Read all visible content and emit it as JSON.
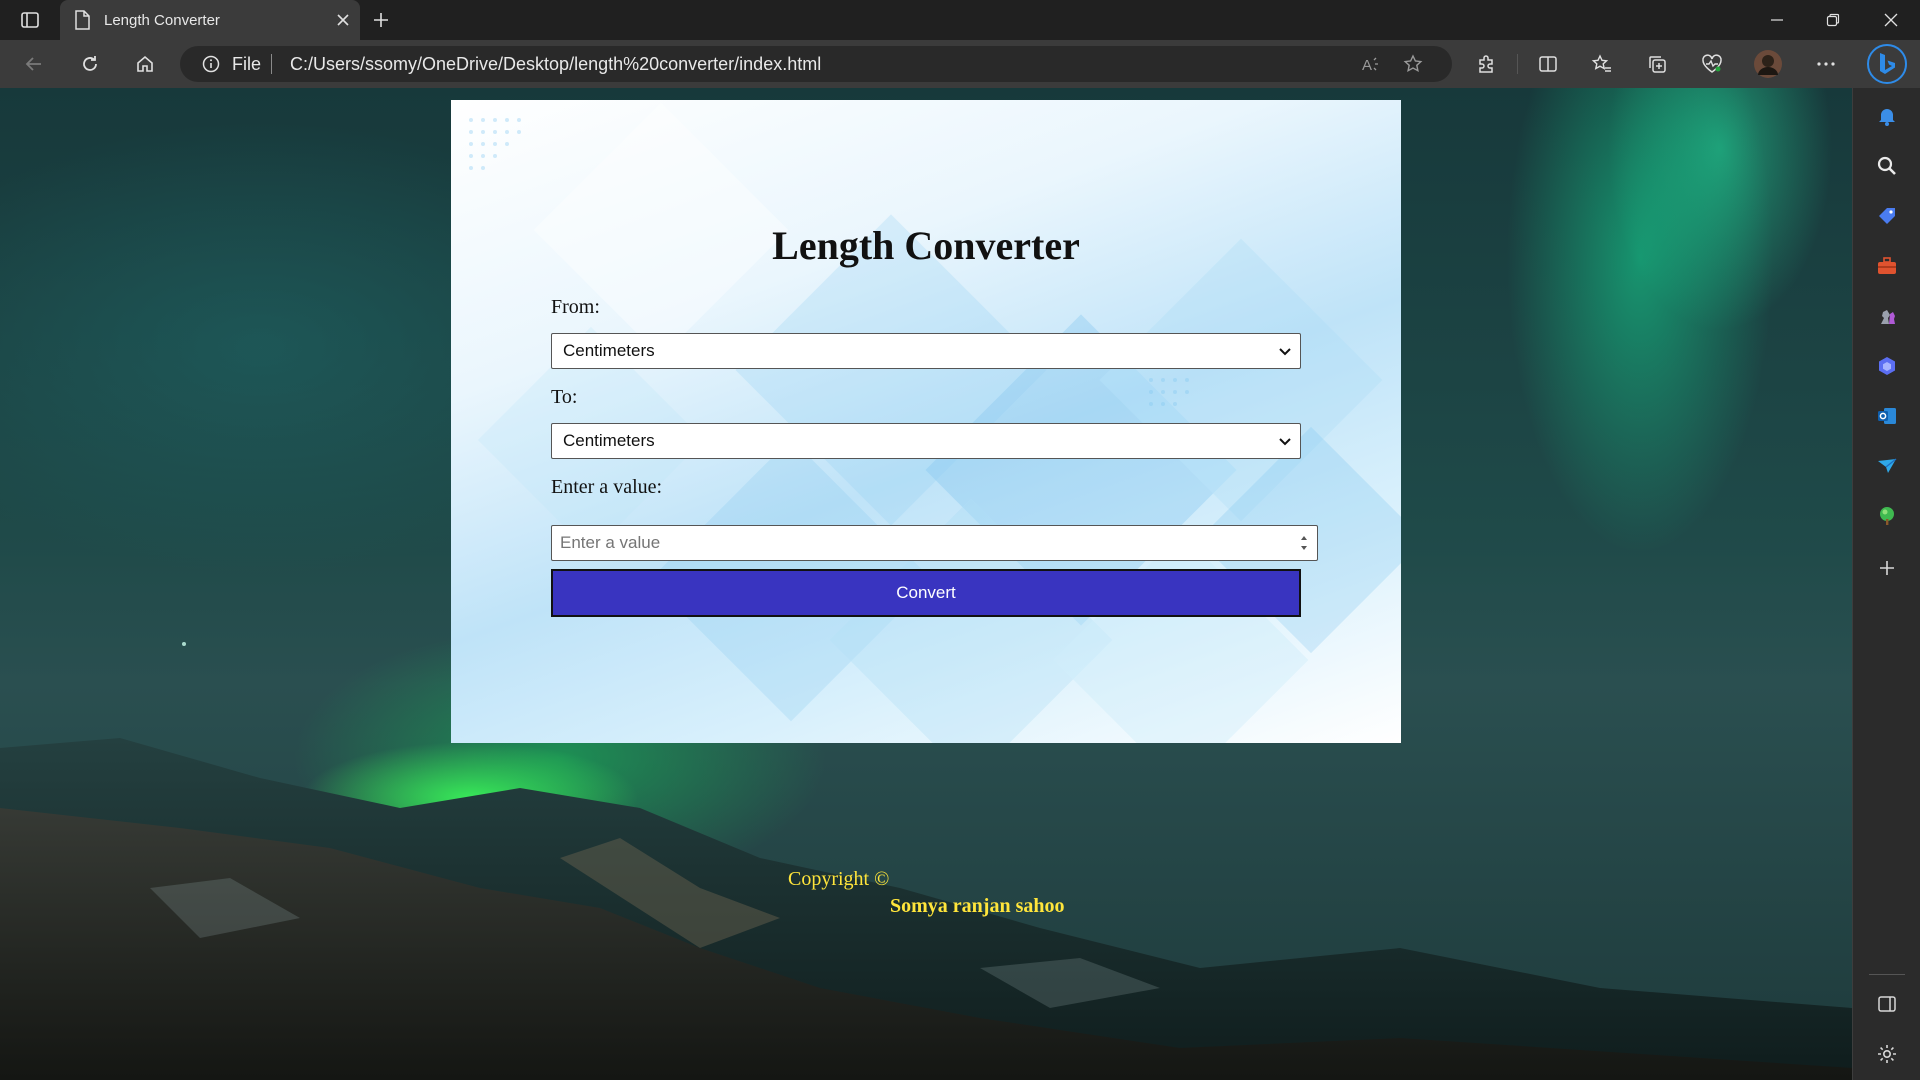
{
  "browser": {
    "tab_title": "Length Converter",
    "address_protocol": "File",
    "address_url": "C:/Users/ssomy/OneDrive/Desktop/length%20converter/index.html"
  },
  "converter": {
    "title": "Length Converter",
    "from_label": "From:",
    "from_value": "Centimeters",
    "to_label": "To:",
    "to_value": "Centimeters",
    "value_label": "Enter a value:",
    "value_placeholder": "Enter a value",
    "convert_label": "Convert"
  },
  "footer": {
    "copyright": "Copyright ©",
    "author": "Somya ranjan sahoo"
  },
  "colors": {
    "button_bg": "#3934c0",
    "footer_text": "#ffe53b",
    "chrome_dark": "#202020",
    "chrome_toolbar": "#3b3b3b"
  },
  "sidebar": {
    "items": [
      "bell-icon",
      "search-icon",
      "tag-icon",
      "toolbox-icon",
      "chess-icon",
      "copilot-icon",
      "outlook-icon",
      "send-icon",
      "tree-icon",
      "add-icon"
    ]
  }
}
